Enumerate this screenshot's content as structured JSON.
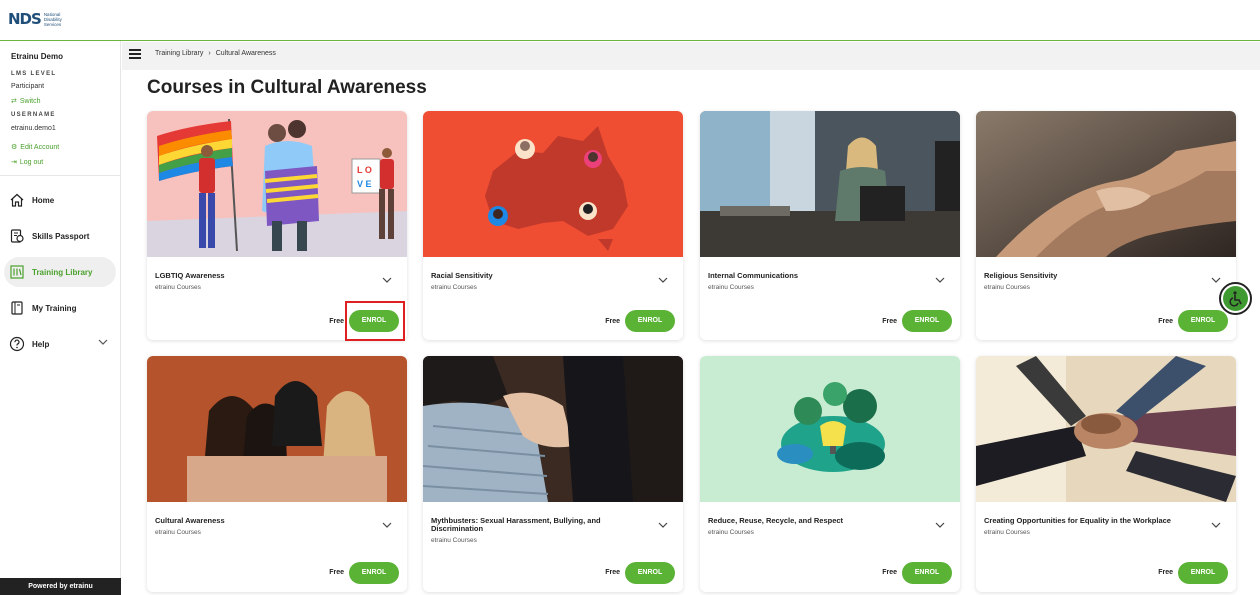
{
  "brand": {
    "logo_mark": "NDS",
    "logo_text": "National Disability Services"
  },
  "sidebar": {
    "user_name": "Etrainu Demo",
    "lms_level_label": "LMS LEVEL",
    "lms_level_value": "Participant",
    "switch_label": "Switch",
    "username_label": "USERNAME",
    "username_value": "etrainu.demo1",
    "edit_account_label": "Edit Account",
    "logout_label": "Log out",
    "nav": [
      {
        "label": "Home",
        "icon": "home-icon"
      },
      {
        "label": "Skills Passport",
        "icon": "passport-icon"
      },
      {
        "label": "Training Library",
        "icon": "library-icon",
        "active": true
      },
      {
        "label": "My Training",
        "icon": "book-icon"
      },
      {
        "label": "Help",
        "icon": "help-icon"
      }
    ],
    "powered_by": "Powered by etrainu"
  },
  "breadcrumb": {
    "root": "Training Library",
    "current": "Cultural Awareness"
  },
  "page_title": "Courses in Cultural Awareness",
  "courses": [
    {
      "title": "LGBTIQ Awareness",
      "provider": "etrainu Courses",
      "price": "Free",
      "button": "ENROL"
    },
    {
      "title": "Racial Sensitivity",
      "provider": "etrainu Courses",
      "price": "Free",
      "button": "ENROL"
    },
    {
      "title": "Internal Communications",
      "provider": "etrainu Courses",
      "price": "Free",
      "button": "ENROL"
    },
    {
      "title": "Religious Sensitivity",
      "provider": "etrainu Courses",
      "price": "Free",
      "button": "ENROL"
    },
    {
      "title": "Cultural Awareness",
      "provider": "etrainu Courses",
      "price": "Free",
      "button": "ENROL"
    },
    {
      "title": "Mythbusters: Sexual Harassment, Bullying, and Discrimination",
      "provider": "etrainu Courses",
      "price": "Free",
      "button": "ENROL"
    },
    {
      "title": "Reduce, Reuse, Recycle, and Respect",
      "provider": "etrainu Courses",
      "price": "Free",
      "button": "ENROL"
    },
    {
      "title": "Creating Opportunities for Equality in the Workplace",
      "provider": "etrainu Courses",
      "price": "Free",
      "button": "ENROL"
    }
  ],
  "colors": {
    "accent_green": "#5bb336",
    "highlight_red": "#e02020"
  }
}
